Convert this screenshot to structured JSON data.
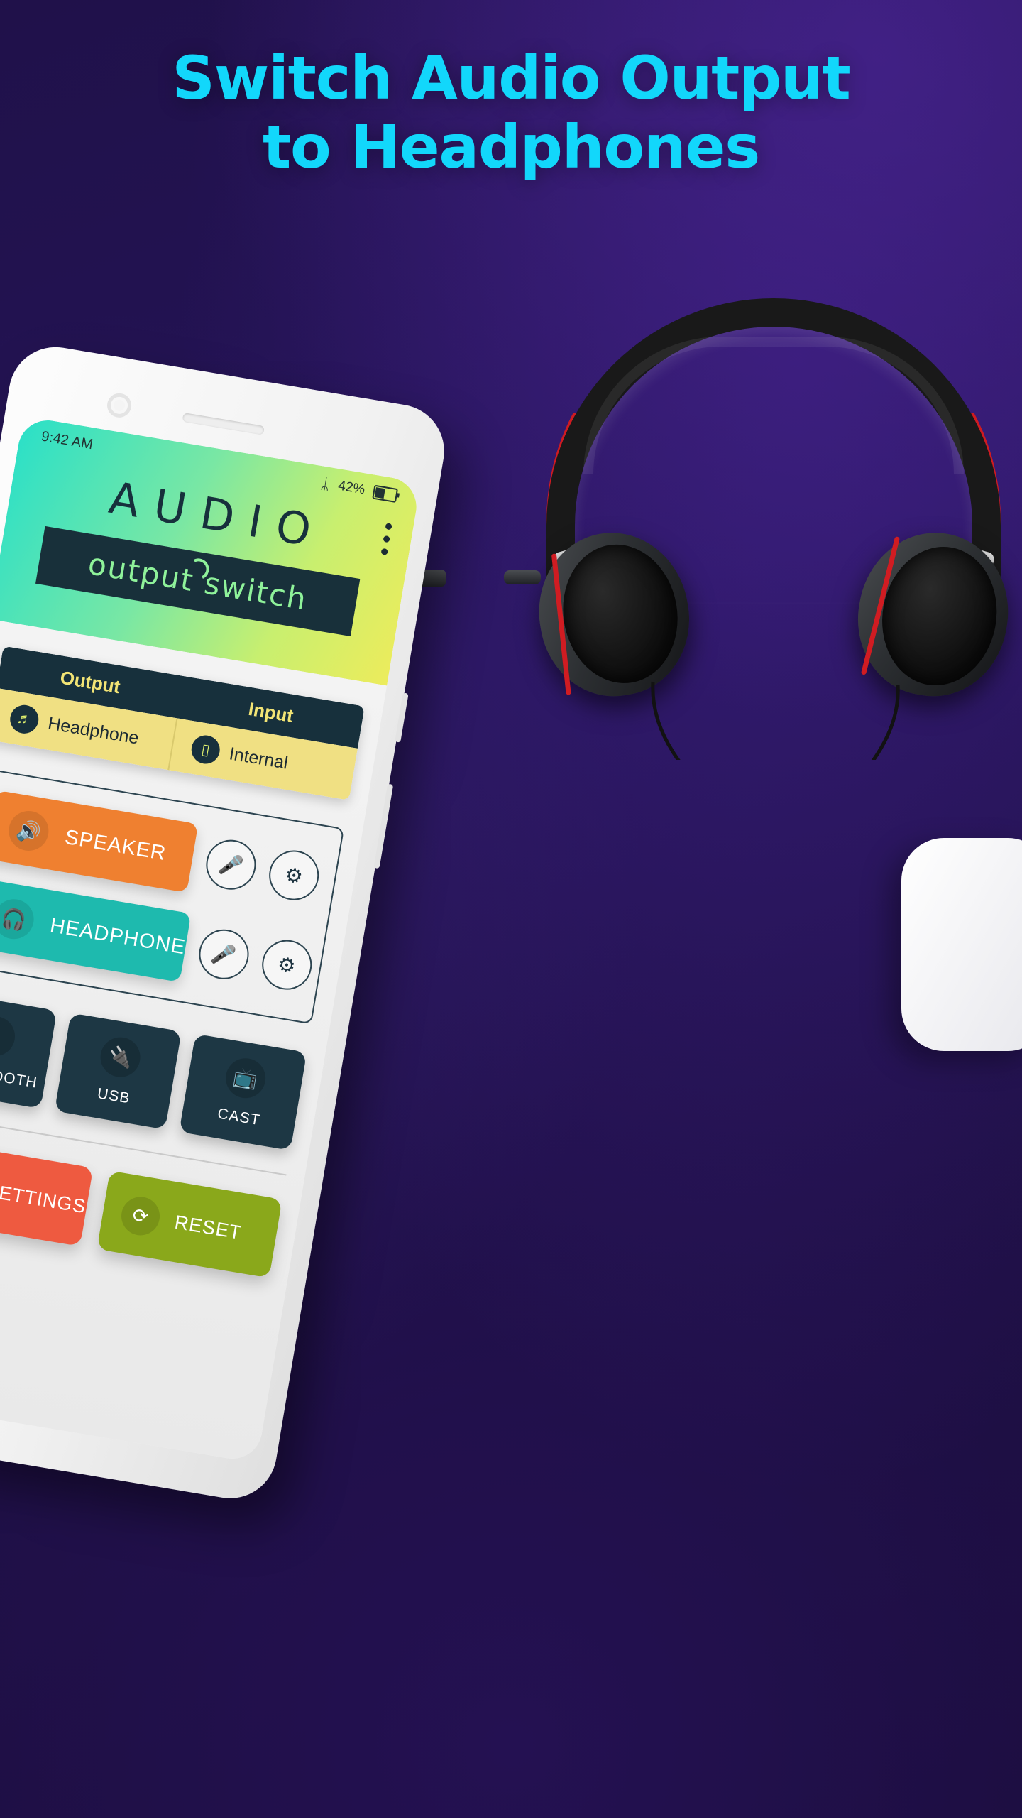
{
  "promo": {
    "headline_line1": "Switch Audio Output",
    "headline_line2": "to Headphones",
    "headline_color": "#12d7fb",
    "background_color": "#20114a"
  },
  "device": {
    "status_bar": {
      "time": "9:42 AM",
      "bluetooth_icon": "bluetooth-icon",
      "battery_percent": "42%",
      "battery_icon": "battery-icon"
    }
  },
  "app": {
    "brand_title": "AUDIO",
    "brand_subtitle": "output switch",
    "menu_icon": "overflow-menu-icon",
    "header_gradient": [
      "#2ae0c8",
      "#ecec5c"
    ],
    "brand_bar_color": "#18303a",
    "brand_subtitle_color": "#8ff29a",
    "io_table": {
      "headers": [
        "Output",
        "Input"
      ],
      "rows": [
        {
          "icon": "headphone-icon",
          "label": "Headphone"
        },
        {
          "icon": "phone-icon",
          "label": "Internal"
        }
      ],
      "header_bg": "#17303c",
      "header_text_color": "#f2e475",
      "row_bg": "#f0e083"
    },
    "outputs": [
      {
        "label": "SPEAKER",
        "icon": "speaker-icon",
        "color": "#ef8030",
        "mic_icon": "microphone-icon",
        "settings_icon": "gear-icon"
      },
      {
        "label": "HEADPHONE",
        "icon": "headphone-icon",
        "color": "#1ebaae",
        "mic_icon": "microphone-icon",
        "settings_icon": "gear-icon"
      }
    ],
    "tiles": [
      {
        "label": "BLUETOOTH",
        "icon": "bluetooth-icon",
        "glyph": "ᛦ"
      },
      {
        "label": "USB",
        "icon": "usb-icon",
        "glyph": "⬌"
      },
      {
        "label": "CAST",
        "icon": "cast-icon",
        "glyph": "◢"
      }
    ],
    "tile_color": "#1d3744",
    "actions": [
      {
        "label": "SETTINGS",
        "icon": "gear-icon",
        "color": "#ee5a40"
      },
      {
        "label": "RESET",
        "icon": "refresh-icon",
        "color": "#8aa81b"
      }
    ]
  }
}
